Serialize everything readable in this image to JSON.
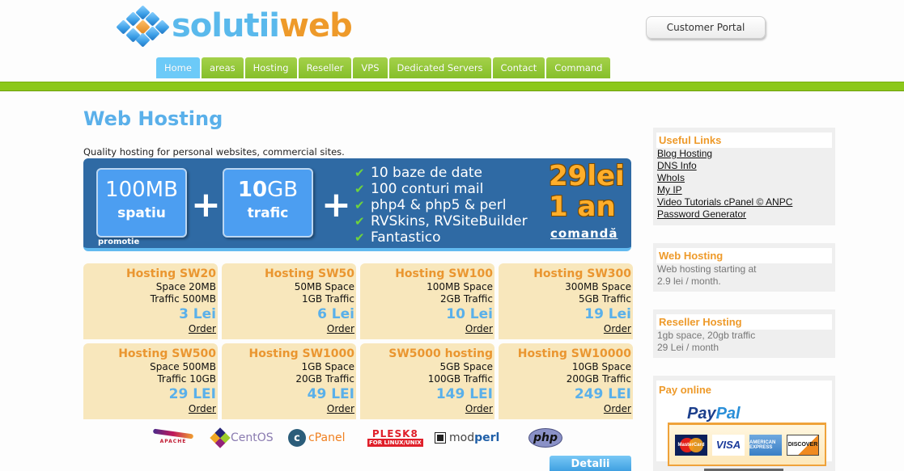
{
  "header": {
    "logo": {
      "part1": "solutii",
      "part2": "web",
      "icon": "cubes-logo-icon"
    },
    "customer_portal": "Customer Portal",
    "nav": [
      {
        "label": "Home",
        "active": true
      },
      {
        "label": "areas",
        "active": false
      },
      {
        "label": "Hosting",
        "active": false
      },
      {
        "label": "Reseller",
        "active": false
      },
      {
        "label": "VPS",
        "active": false
      },
      {
        "label": "Dedicated Servers",
        "active": false
      },
      {
        "label": "Contact",
        "active": false
      },
      {
        "label": "Command",
        "active": false
      }
    ]
  },
  "main": {
    "title": "Web Hosting",
    "intro": "Quality hosting for personal websites, commercial sites.",
    "banner": {
      "box1_value": "100",
      "box1_unit": "MB",
      "box1_label": "spatiu",
      "box2_value": "10",
      "box2_unit": "GB",
      "box2_label": "trafic",
      "plus": "+",
      "promo": "promotie",
      "features": [
        "10 baze de date",
        "100 conturi mail",
        "php4 & php5 & perl",
        "RVSkins, RVSiteBuilder",
        "Fantastico"
      ],
      "price": "29lei",
      "period": "1 an",
      "order_label": "comandă",
      "check_icon": "✔"
    },
    "plans": [
      {
        "name": "Hosting SW20",
        "line1": "Space 20MB",
        "line2": "Traffic 500MB",
        "price": "3 Lei",
        "order": "Order"
      },
      {
        "name": "Hosting SW50",
        "line1": "50MB Space",
        "line2": "1GB Traffic",
        "price": "6 Lei",
        "order": "Order"
      },
      {
        "name": "Hosting SW100",
        "line1": "100MB Space",
        "line2": "2GB Traffic",
        "price": "10 Lei",
        "order": "Order"
      },
      {
        "name": "Hosting SW300",
        "line1": "300MB Space",
        "line2": "5GB Traffic",
        "price": "19 Lei",
        "order": "Order"
      },
      {
        "name": "Hosting SW500",
        "line1": "Space 500MB",
        "line2": "Traffic 10GB",
        "price": "29 LEI",
        "order": "Order"
      },
      {
        "name": "Hosting SW1000",
        "line1": "1GB Space",
        "line2": "20GB Traffic",
        "price": "49 LEI",
        "order": "Order"
      },
      {
        "name": "SW5000 hosting",
        "line1": "5GB Space",
        "line2": "100GB Traffic",
        "price": "149 LEI",
        "order": "Order"
      },
      {
        "name": "Hosting SW10000",
        "line1": "10GB Space",
        "line2": "200GB Traffic",
        "price": "249 LEI",
        "order": "Order"
      }
    ],
    "tech_logos": {
      "apache": "APACHE",
      "centos": "CentOS",
      "cpanel": "cPanel",
      "cpanel_mark": "c",
      "plesk": "PLESK8",
      "plesk_sub": "FOR LINUX/UNIX",
      "modperl_a": "mod",
      "modperl_b": "perl",
      "php": "php"
    },
    "details_button": "Detalii"
  },
  "sidebar": {
    "useful_links": {
      "title": "Useful Links",
      "links": [
        "Blog Hosting ",
        "DNS Info ",
        "WhoIs ",
        "My IP ",
        "Video Tutorials cPanel © ANPC ",
        "Password Generator"
      ]
    },
    "web_hosting": {
      "title": "Web Hosting",
      "line1": "Web hosting starting at",
      "line2": "2.9 lei / month."
    },
    "reseller_hosting": {
      "title": "Reseller Hosting",
      "line1": "1gb space, 20gb traffic",
      "line2": "29 Lei / month"
    },
    "pay_online": {
      "title": "Pay online",
      "paypal_a": "Pay",
      "paypal_b": "Pal",
      "cards": [
        "MasterCard",
        "VISA",
        "AMERICAN EXPRESS",
        "DISCOVER"
      ]
    }
  }
}
